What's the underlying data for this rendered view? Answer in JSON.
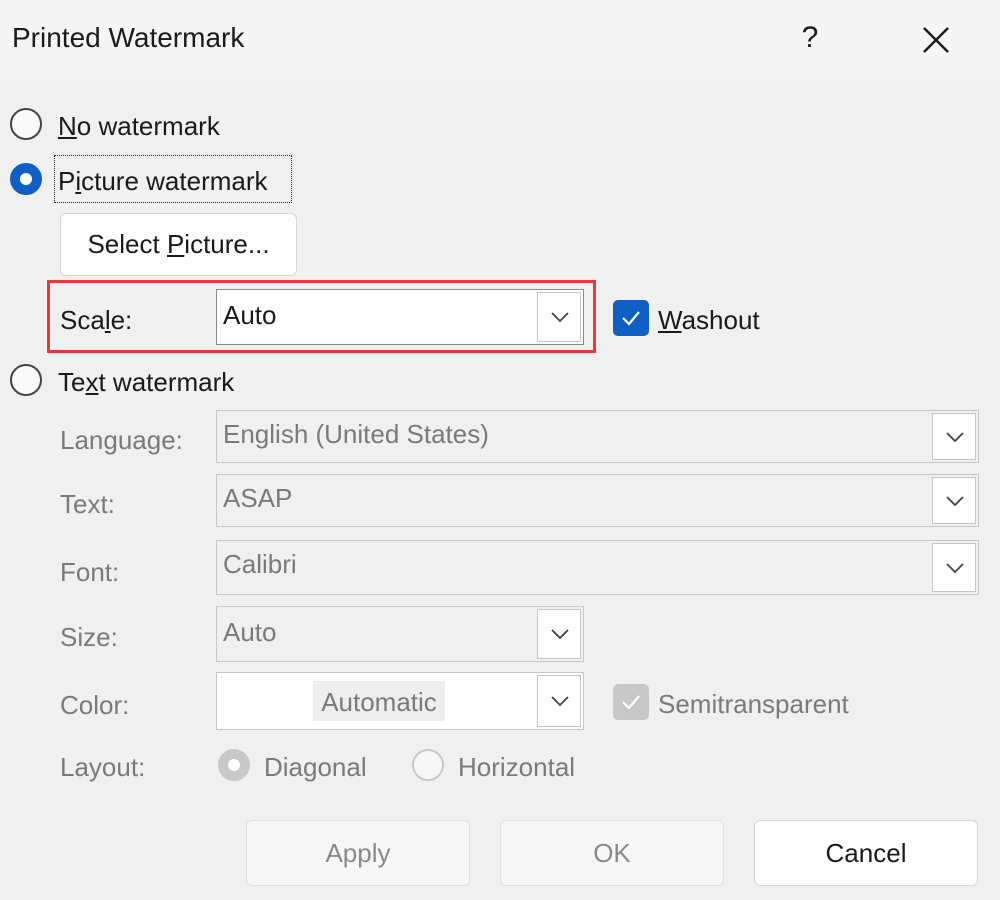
{
  "window": {
    "title": "Printed Watermark",
    "help_label": "?"
  },
  "options": {
    "no_watermark": {
      "pre": "",
      "acc": "N",
      "post": "o watermark",
      "selected": false
    },
    "picture_watermark": {
      "pre": "P",
      "acc": "i",
      "post": "cture watermark",
      "selected": true
    },
    "text_watermark": {
      "pre": "Te",
      "acc": "x",
      "post": "t watermark",
      "selected": false
    }
  },
  "picture": {
    "select_button": {
      "pre": "Select ",
      "acc": "P",
      "post": "icture..."
    },
    "scale_label": {
      "pre": "Sca",
      "acc": "l",
      "post": "e:"
    },
    "scale_value": "Auto",
    "washout": {
      "pre": "",
      "acc": "W",
      "post": "ashout",
      "checked": true
    }
  },
  "text_options": {
    "language_label": "Language:",
    "language_value": "English (United States)",
    "text_label": "Text:",
    "text_value": "ASAP",
    "font_label": "Font:",
    "font_value": "Calibri",
    "size_label": "Size:",
    "size_value": "Auto",
    "color_label": "Color:",
    "color_value": "Automatic",
    "semitransparent_label": "Semitransparent",
    "semitransparent_checked": true,
    "layout_label": "Layout:",
    "layout_diagonal": "Diagonal",
    "layout_horizontal": "Horizontal",
    "layout_selected": "Diagonal"
  },
  "buttons": {
    "apply": "Apply",
    "ok": "OK",
    "cancel": "Cancel"
  },
  "colors": {
    "accent": "#0f5fc4",
    "highlight_box": "#e53a3a",
    "disabled_text": "#7a7a7a"
  }
}
